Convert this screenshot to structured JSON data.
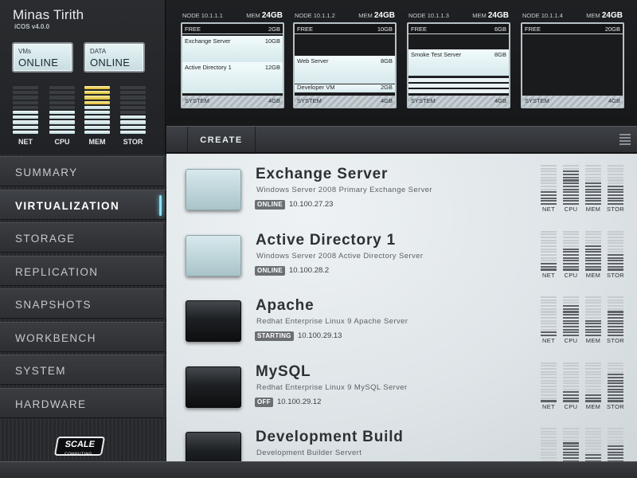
{
  "brand": {
    "title": "Minas Tirith",
    "version": "iCOS v4.0.0"
  },
  "status": {
    "vms": {
      "label": "VMs",
      "value": "ONLINE"
    },
    "data": {
      "label": "DATA",
      "value": "ONLINE"
    }
  },
  "cluster_meters": [
    {
      "label": "NET",
      "level": 5,
      "state": "normal"
    },
    {
      "label": "CPU",
      "level": 5,
      "state": "normal"
    },
    {
      "label": "MEM",
      "level": 10,
      "state": "warning"
    },
    {
      "label": "STOR",
      "level": 4,
      "state": "normal"
    }
  ],
  "nodes": [
    {
      "name": "NODE 10.1.1.1",
      "mem_label": "MEM",
      "mem": "24GB",
      "free_label": "FREE",
      "free": "2GB",
      "vms": [
        {
          "name": "Exchange Server",
          "size": "10GB"
        },
        {
          "name": "Active Directory 1",
          "size": "12GB"
        }
      ],
      "system_label": "SYSTEM",
      "system": "4GB"
    },
    {
      "name": "NODE 10.1.1.2",
      "mem_label": "MEM",
      "mem": "24GB",
      "free_label": "FREE",
      "free": "10GB",
      "vms": [
        {
          "name": "Web Server",
          "size": "8GB"
        },
        {
          "name": "Developer VM",
          "size": "2GB"
        }
      ],
      "system_label": "SYSTEM",
      "system": "4GB"
    },
    {
      "name": "NODE 10.1.1.3",
      "mem_label": "MEM",
      "mem": "24GB",
      "free_label": "FREE",
      "free": "6GB",
      "vms": [
        {
          "name": "Smoke Test Server",
          "size": "8GB"
        }
      ],
      "system_label": "SYSTEM",
      "system": "4GB"
    },
    {
      "name": "NODE 10.1.1.4",
      "mem_label": "MEM",
      "mem": "24GB",
      "free_label": "FREE",
      "free": "20GB",
      "vms": [],
      "system_label": "SYSTEM",
      "system": "4GB"
    }
  ],
  "toolbar": {
    "create_label": "CREATE"
  },
  "sidebar": {
    "items": [
      {
        "label": "SUMMARY",
        "active": false
      },
      {
        "label": "VIRTUALIZATION",
        "active": true
      },
      {
        "label": "STORAGE",
        "active": false
      },
      {
        "label": "REPLICATION",
        "active": false
      },
      {
        "label": "SNAPSHOTS",
        "active": false
      },
      {
        "label": "WORKBENCH",
        "active": false
      },
      {
        "label": "SYSTEM",
        "active": false
      },
      {
        "label": "HARDWARE",
        "active": false
      }
    ],
    "logo_text": "SCALE"
  },
  "meter_labels": [
    "NET",
    "CPU",
    "MEM",
    "STOR"
  ],
  "vm_list": [
    {
      "name": "Exchange Server",
      "description": "Windows Server 2008 Primary Exchange Server",
      "state": "ONLINE",
      "ip": "10.100.27.23",
      "running": true,
      "meters": [
        5,
        12,
        8,
        7
      ]
    },
    {
      "name": "Active Directory 1",
      "description": "Windows Server 2008 Active Directory Server",
      "state": "ONLINE",
      "ip": "10.100.28.2",
      "running": true,
      "meters": [
        3,
        8,
        9,
        6
      ]
    },
    {
      "name": "Apache",
      "description": "Redhat Enterprise Linux 9 Apache Server",
      "state": "STARTING",
      "ip": "10.100.29.13",
      "running": false,
      "meters": [
        2,
        11,
        6,
        9
      ]
    },
    {
      "name": "MySQL",
      "description": "Redhat Enterprise Linux 9 MySQL Server",
      "state": "OFF",
      "ip": "10.100.29.12",
      "running": false,
      "meters": [
        1,
        4,
        3,
        10
      ]
    },
    {
      "name": "Development Build",
      "description": "Development Builder Servert",
      "state": "",
      "ip": "",
      "running": false,
      "meters": [
        2,
        9,
        5,
        8
      ]
    }
  ]
}
